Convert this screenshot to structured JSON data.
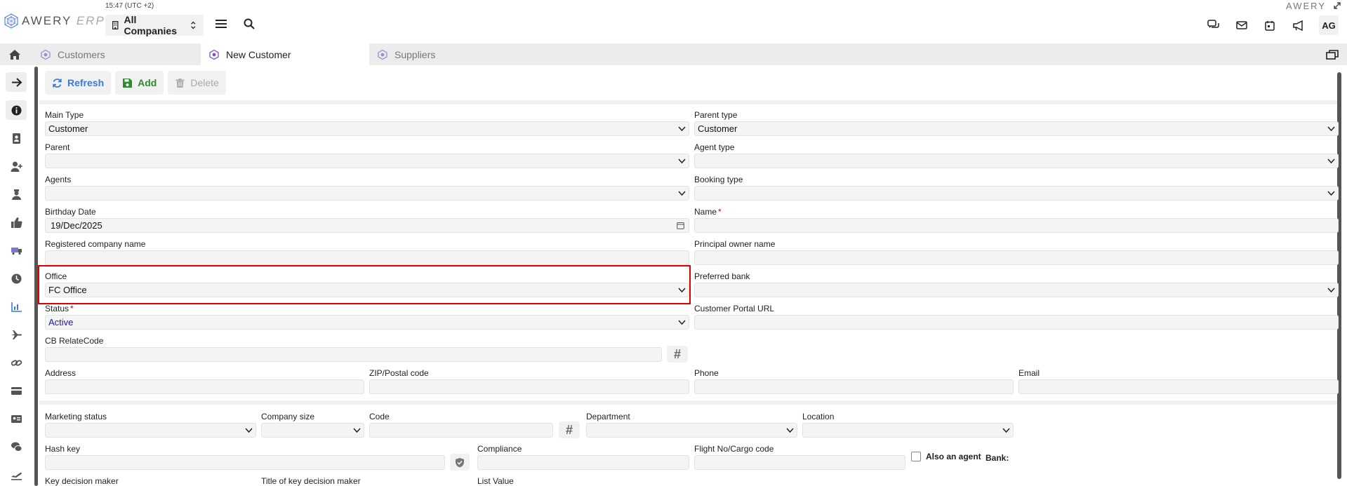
{
  "app": {
    "brand_main": "AWERY",
    "brand_sub": "ERP",
    "clock": "15:47 (UTC +2)",
    "company": "All Companies",
    "right_brand": "AWERY",
    "user_initials": "AG"
  },
  "tabs": [
    {
      "label": "Customers"
    },
    {
      "label": "New Customer"
    },
    {
      "label": "Suppliers"
    }
  ],
  "toolbar": {
    "refresh": "Refresh",
    "add": "Add",
    "delete": "Delete"
  },
  "form": {
    "main_type": {
      "label": "Main Type",
      "value": "Customer"
    },
    "parent_type": {
      "label": "Parent type",
      "value": "Customer"
    },
    "parent": {
      "label": "Parent",
      "value": ""
    },
    "agent_type": {
      "label": "Agent type",
      "value": ""
    },
    "agents": {
      "label": "Agents",
      "value": ""
    },
    "booking_type": {
      "label": "Booking type",
      "value": ""
    },
    "birthday": {
      "label": "Birthday Date",
      "value": "19/Dec/2025"
    },
    "name": {
      "label": "Name",
      "value": ""
    },
    "registered_company": {
      "label": "Registered company name",
      "value": ""
    },
    "principal_owner": {
      "label": "Principal owner name",
      "value": ""
    },
    "office": {
      "label": "Office",
      "value": "FC Office"
    },
    "preferred_bank": {
      "label": "Preferred bank",
      "value": ""
    },
    "status": {
      "label": "Status",
      "value": "Active"
    },
    "portal_url": {
      "label": "Customer Portal URL",
      "value": ""
    },
    "cb_relate": {
      "label": "CB RelateCode",
      "value": ""
    },
    "address": {
      "label": "Address",
      "value": ""
    },
    "zip": {
      "label": "ZIP/Postal code",
      "value": ""
    },
    "phone": {
      "label": "Phone",
      "value": ""
    },
    "email": {
      "label": "Email",
      "value": ""
    },
    "marketing_status": {
      "label": "Marketing status",
      "value": ""
    },
    "company_size": {
      "label": "Company size",
      "value": ""
    },
    "code": {
      "label": "Code",
      "value": ""
    },
    "department": {
      "label": "Department",
      "value": ""
    },
    "location": {
      "label": "Location",
      "value": ""
    },
    "hash_key": {
      "label": "Hash key",
      "value": ""
    },
    "compliance": {
      "label": "Compliance",
      "value": ""
    },
    "flight_no": {
      "label": "Flight No/Cargo code",
      "value": ""
    },
    "also_agent": {
      "label": "Also an agent"
    },
    "bank": {
      "label": "Bank:"
    },
    "key_decision_maker": {
      "label": "Key decision maker"
    },
    "title_key_decision_maker": {
      "label": "Title of key decision maker"
    },
    "list_value": {
      "label": "List Value"
    }
  },
  "hash_symbol": "#",
  "colors": {
    "accent": "#3a7bd5",
    "add": "#2e8b2e",
    "highlight": "#e00000",
    "status_active": "#1a1aa6",
    "tab_icon": "#7b4fc9"
  }
}
